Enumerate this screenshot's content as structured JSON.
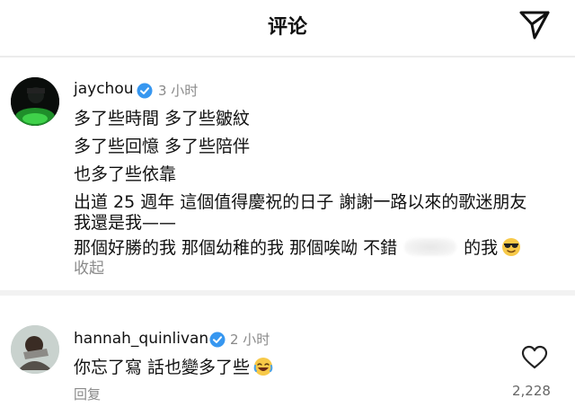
{
  "header": {
    "title": "评论"
  },
  "comment1": {
    "username": "jaychou",
    "time": "3 小时",
    "lines": [
      "多了些時間 多了些皺紋",
      "多了些回憶 多了些陪伴",
      "也多了些依靠",
      "出道 25 週年 這個值得慶祝的日子 謝謝一路以來的歌迷朋友",
      "我還是我——"
    ],
    "last_line_a": "那個好勝的我 那個幼稚的我 那個唉呦 不錯",
    "last_line_b": "的我",
    "collapse_label": "收起"
  },
  "comment2": {
    "username": "hannah_quinlivan",
    "time": "2 小时",
    "text": "你忘了寫 話也變多了些",
    "reply_label": "回复",
    "likes": "2,228"
  },
  "colors": {
    "verified": "#3797f0",
    "muted": "#8a8a8a",
    "text": "#111111"
  }
}
